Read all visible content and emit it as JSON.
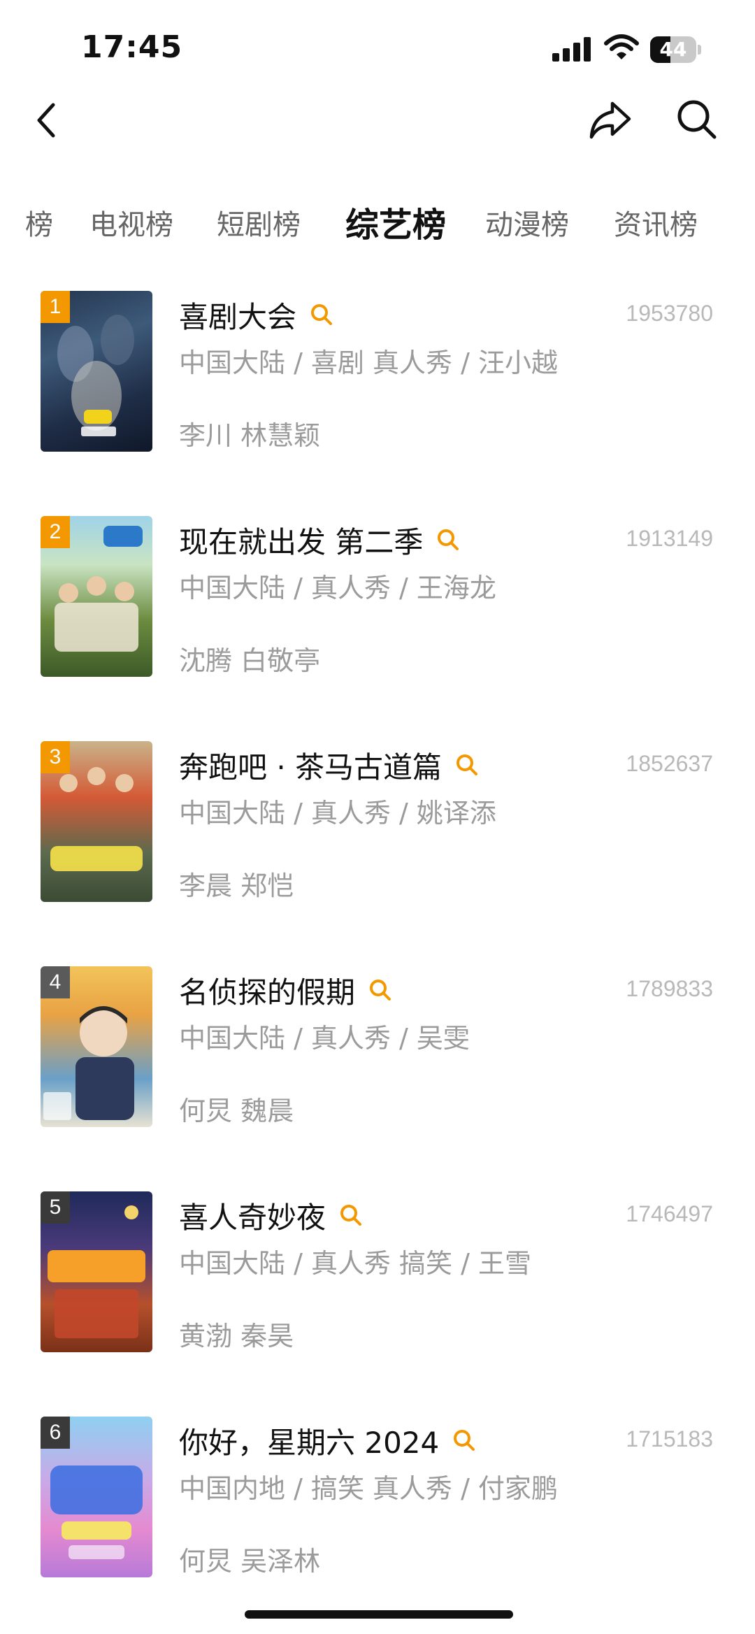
{
  "status_bar": {
    "time": "17:45",
    "battery": "44",
    "battery_level": 0.44
  },
  "tabs": [
    {
      "label": "榜",
      "active": false
    },
    {
      "label": "电视榜",
      "active": false
    },
    {
      "label": "短剧榜",
      "active": false
    },
    {
      "label": "综艺榜",
      "active": true
    },
    {
      "label": "动漫榜",
      "active": false
    },
    {
      "label": "资讯榜",
      "active": false
    }
  ],
  "items": [
    {
      "rank": "1",
      "title": "喜剧大会",
      "score": "1953780",
      "meta": "中国大陆 / 喜剧 真人秀 / 汪小越",
      "cast": "李川 林慧颖",
      "rank_color": "#f39800"
    },
    {
      "rank": "2",
      "title": "现在就出发 第二季",
      "score": "1913149",
      "meta": "中国大陆 / 真人秀 / 王海龙",
      "cast": "沈腾 白敬亭",
      "rank_color": "#f39800"
    },
    {
      "rank": "3",
      "title": "奔跑吧 · 茶马古道篇",
      "score": "1852637",
      "meta": "中国大陆 / 真人秀 / 姚译添",
      "cast": "李晨 郑恺",
      "rank_color": "#f39800"
    },
    {
      "rank": "4",
      "title": "名侦探的假期",
      "score": "1789833",
      "meta": "中国大陆 / 真人秀 / 吴雯",
      "cast": "何炅 魏晨",
      "rank_color": "#5a5a5a"
    },
    {
      "rank": "5",
      "title": "喜人奇妙夜",
      "score": "1746497",
      "meta": "中国大陆 / 真人秀 搞笑 / 王雪",
      "cast": "黄渤 秦昊",
      "rank_color": "#3a3a3a"
    },
    {
      "rank": "6",
      "title": "你好，星期六 2024",
      "score": "1715183",
      "meta": "中国内地 / 搞笑 真人秀 / 付家鹏",
      "cast": "何炅 吴泽林",
      "rank_color": "#3a3a3a"
    }
  ],
  "colors": {
    "accent": "#f39800",
    "muted": "#9b9b9b",
    "score": "#b8b8b8"
  },
  "icons": {
    "back": "chevron-left-icon",
    "share": "share-icon",
    "search": "search-icon"
  }
}
